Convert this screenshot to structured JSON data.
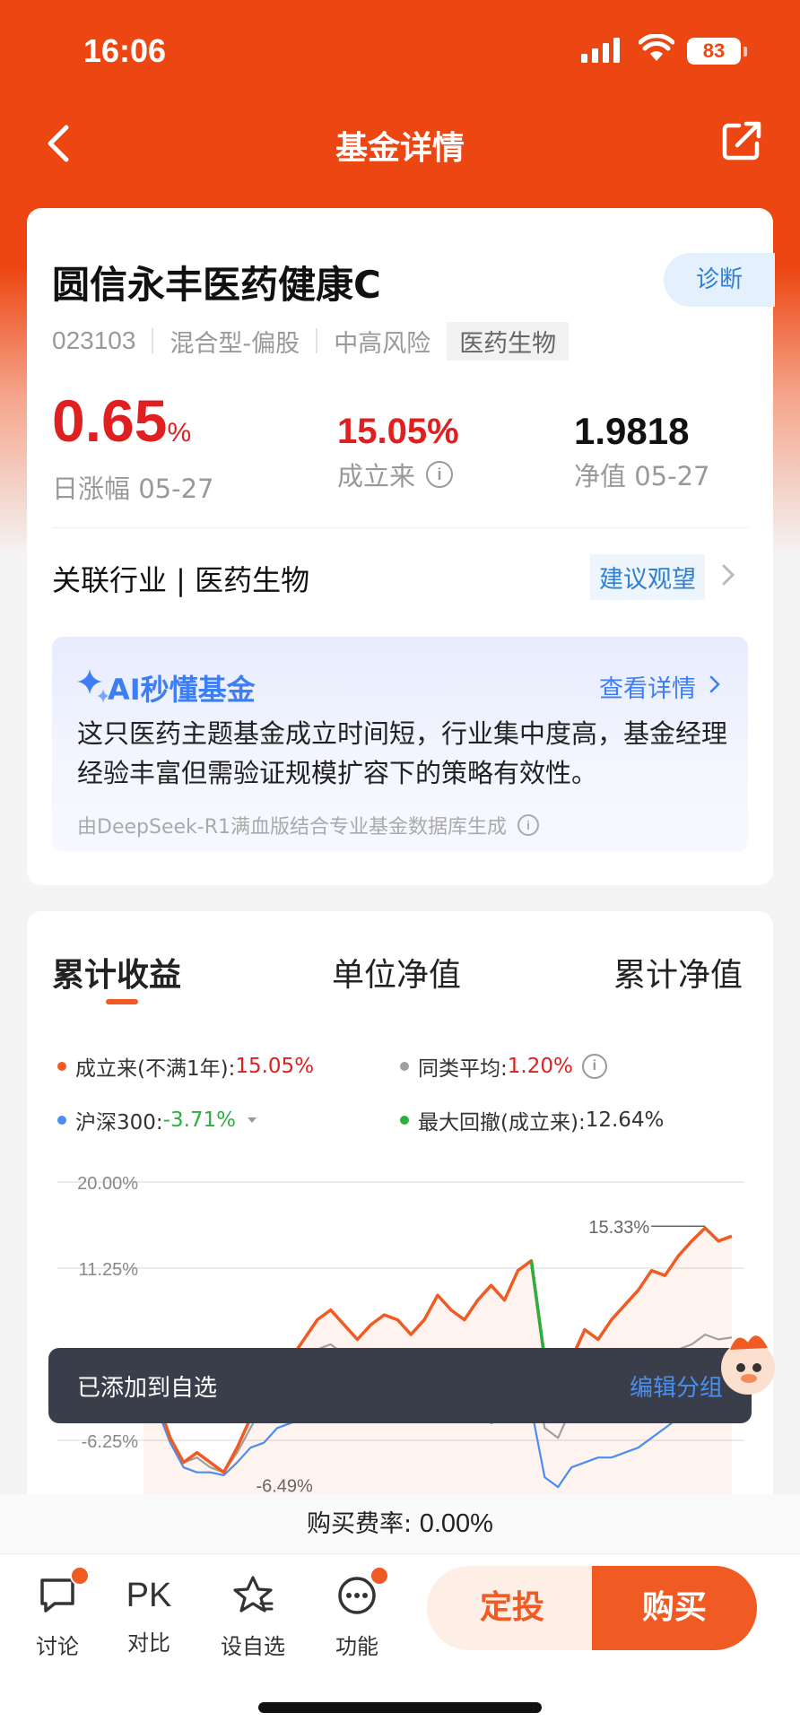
{
  "status_bar": {
    "time": "16:06",
    "battery": "83"
  },
  "nav": {
    "title": "基金详情"
  },
  "fund": {
    "name": "圆信永丰医药健康C",
    "diagnose_label": "诊断",
    "code": "023103",
    "type": "混合型-偏股",
    "risk": "中高风险",
    "sector_tag": "医药生物",
    "daily_change_value": "0.65",
    "daily_change_unit": "%",
    "daily_change_label": "日涨幅 05-27",
    "since_inception_value": "15.05%",
    "since_inception_label": "成立来",
    "nav_value": "1.9818",
    "nav_label": "净值 05-27",
    "industry_text": "关联行业 | 医药生物",
    "advice": "建议观望"
  },
  "ai": {
    "title": "AI秒懂基金",
    "more": "查看详情",
    "summary": "这只医药主题基金成立时间短，行业集中度高，基金经理经验丰富但需验证规模扩容下的策略有效性。",
    "source": "由DeepSeek-R1满血版结合专业基金数据库生成"
  },
  "tabs": [
    "累计收益",
    "单位净值",
    "累计净值"
  ],
  "legend": {
    "fund_label": "成立来(不满1年):",
    "fund_value": "15.05%",
    "peer_label": "同类平均:",
    "peer_value": "1.20%",
    "index_label": "沪深300:",
    "index_value": "-3.71%",
    "drawdown_label": "最大回撤(成立来):",
    "drawdown_value": "12.64%"
  },
  "colors": {
    "brand": "#ec4713",
    "fund_line": "#f05a23",
    "peer_line": "#a0a0a0",
    "index_line": "#4a8ef0",
    "drawdown_line": "#2bb03d"
  },
  "chart_data": {
    "type": "line",
    "y_ticks": [
      "20.00%",
      "11.25%",
      "-6.25%"
    ],
    "peak_label": "15.33%",
    "low_label": "-6.49%",
    "series": [
      {
        "name": "成立来(不满1年)",
        "values": [
          0.0,
          -2.0,
          -6.0,
          -8.5,
          -7.5,
          -8.5,
          -9.5,
          -7.0,
          -4.0,
          -1.0,
          0.5,
          2.0,
          4.0,
          6.0,
          7.0,
          5.5,
          4.0,
          5.5,
          6.5,
          6.0,
          4.5,
          6.0,
          8.5,
          7.0,
          6.0,
          8.0,
          9.5,
          8.0,
          11.0,
          12.0,
          2.0,
          -1.0,
          2.0,
          5.0,
          4.0,
          6.0,
          7.5,
          9.0,
          11.0,
          10.5,
          12.5,
          14.0,
          15.33,
          14.0,
          14.5
        ]
      },
      {
        "name": "同类平均",
        "values": [
          0.0,
          -2.0,
          -6.0,
          -8.5,
          -8.0,
          -9.0,
          -9.5,
          -7.5,
          -5.0,
          -2.5,
          -1.0,
          0.5,
          2.0,
          3.0,
          3.5,
          2.5,
          1.5,
          2.5,
          3.0,
          2.0,
          1.0,
          2.0,
          3.0,
          2.0,
          1.0,
          2.0,
          2.5,
          1.0,
          2.0,
          3.0,
          -5.0,
          -6.0,
          -3.0,
          -1.0,
          -2.0,
          -1.0,
          0.5,
          1.5,
          2.5,
          2.0,
          3.0,
          3.5,
          4.5,
          4.0,
          4.2
        ]
      },
      {
        "name": "沪深300",
        "values": [
          0.0,
          -3.0,
          -6.5,
          -9.0,
          -9.5,
          -9.5,
          -9.8,
          -8.5,
          -7.0,
          -6.5,
          -5.0,
          -4.5,
          -4.0,
          -3.5,
          -3.0,
          -3.5,
          -4.0,
          -3.0,
          -3.5,
          -3.0,
          -4.0,
          -3.5,
          -3.0,
          -3.5,
          -4.0,
          -3.5,
          -4.5,
          -4.0,
          -3.5,
          -3.0,
          -10.0,
          -11.0,
          -9.0,
          -8.5,
          -8.0,
          -8.0,
          -7.5,
          -7.0,
          -6.0,
          -5.0,
          -4.0,
          -3.0,
          -2.5,
          -3.0,
          -3.71
        ]
      }
    ]
  },
  "toast": {
    "text": "已添加到自选",
    "action": "编辑分组"
  },
  "bottom": {
    "fee_label": "购买费率:",
    "fee_value": "0.00%",
    "discuss": "讨论",
    "pk": "PK",
    "compare": "对比",
    "watch": "设自选",
    "more": "功能",
    "sip": "定投",
    "buy": "购买"
  }
}
